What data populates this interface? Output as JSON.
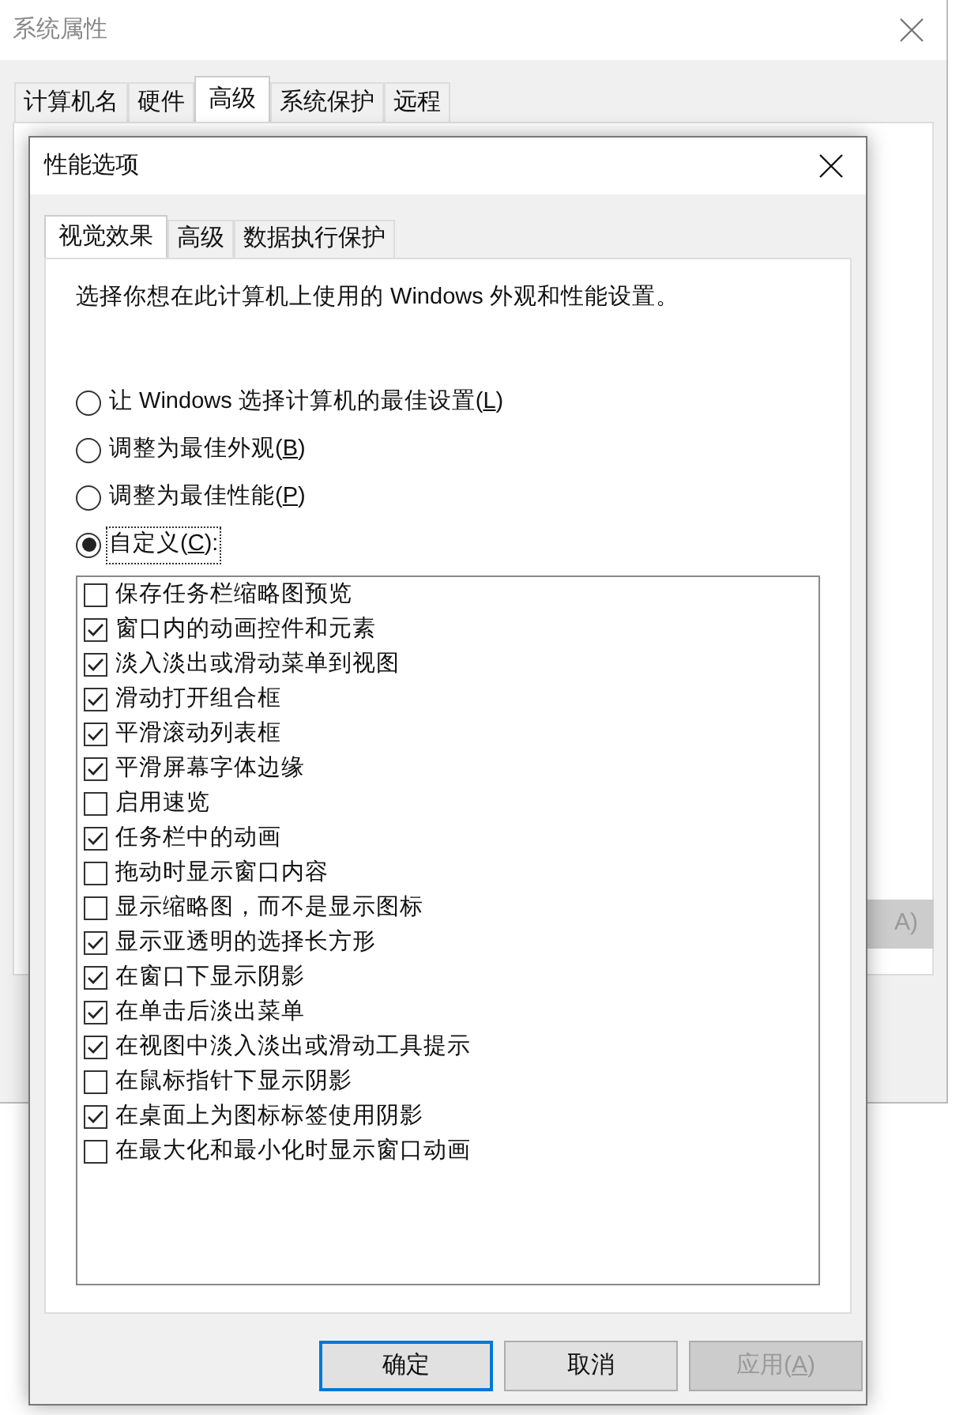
{
  "window": {
    "title": "系统属性"
  },
  "tabs": [
    {
      "label": "计算机名",
      "selected": false
    },
    {
      "label": "硬件",
      "selected": false
    },
    {
      "label": "高级",
      "selected": true
    },
    {
      "label": "系统保护",
      "selected": false
    },
    {
      "label": "远程",
      "selected": false
    }
  ],
  "background_button": {
    "label": "A)"
  },
  "dialog": {
    "title": "性能选项",
    "tabs": [
      {
        "label": "视觉效果",
        "selected": true
      },
      {
        "label": "高级",
        "selected": false
      },
      {
        "label": "数据执行保护",
        "selected": false
      }
    ],
    "description": "选择你想在此计算机上使用的 Windows 外观和性能设置。",
    "options": [
      {
        "before": "让 Windows 选择计算机的最佳设置(",
        "key": "L",
        "after": ")",
        "selected": false
      },
      {
        "before": "调整为最佳外观(",
        "key": "B",
        "after": ")",
        "selected": false
      },
      {
        "before": "调整为最佳性能(",
        "key": "P",
        "after": ")",
        "selected": false
      },
      {
        "before": "自定义(",
        "key": "C",
        "after": "):",
        "selected": true
      }
    ],
    "effects": [
      {
        "label": "保存任务栏缩略图预览",
        "checked": false
      },
      {
        "label": "窗口内的动画控件和元素",
        "checked": true
      },
      {
        "label": "淡入淡出或滑动菜单到视图",
        "checked": true
      },
      {
        "label": "滑动打开组合框",
        "checked": true
      },
      {
        "label": "平滑滚动列表框",
        "checked": true
      },
      {
        "label": "平滑屏幕字体边缘",
        "checked": true
      },
      {
        "label": "启用速览",
        "checked": false
      },
      {
        "label": "任务栏中的动画",
        "checked": true
      },
      {
        "label": "拖动时显示窗口内容",
        "checked": false
      },
      {
        "label": "显示缩略图，而不是显示图标",
        "checked": false
      },
      {
        "label": "显示亚透明的选择长方形",
        "checked": true
      },
      {
        "label": "在窗口下显示阴影",
        "checked": true
      },
      {
        "label": "在单击后淡出菜单",
        "checked": true
      },
      {
        "label": "在视图中淡入淡出或滑动工具提示",
        "checked": true
      },
      {
        "label": "在鼠标指针下显示阴影",
        "checked": false
      },
      {
        "label": "在桌面上为图标标签使用阴影",
        "checked": true
      },
      {
        "label": "在最大化和最小化时显示窗口动画",
        "checked": false
      }
    ],
    "buttons": [
      {
        "before": "确定",
        "kind": "default",
        "disabled": false
      },
      {
        "before": "取消",
        "kind": "normal",
        "disabled": false
      },
      {
        "before": "应用(",
        "key": "A",
        "after": ")",
        "kind": "normal",
        "disabled": true
      }
    ]
  }
}
